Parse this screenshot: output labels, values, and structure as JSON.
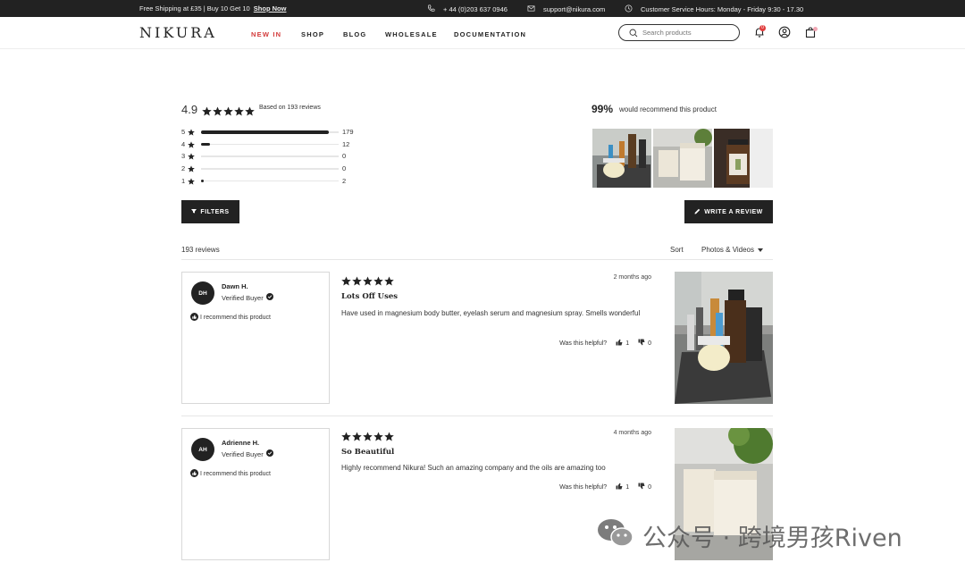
{
  "topbar": {
    "promo_text": "Free Shipping at £35 | Buy 10 Get 10",
    "promo_link": "Shop Now",
    "phone": "+ 44 (0)203 637 0946",
    "email": "support@nikura.com",
    "hours": "Customer Service Hours: Monday - Friday 9:30 - 17.30"
  },
  "header": {
    "logo": "NIKURA",
    "nav": [
      "NEW IN",
      "SHOP",
      "BLOG",
      "WHOLESALE",
      "DOCUMENTATION"
    ],
    "search_placeholder": "Search products",
    "wishlist_count": "0"
  },
  "summary": {
    "average": "4.9",
    "based_on": "Based on 193 reviews",
    "distribution": [
      {
        "stars": "5",
        "count": "179",
        "fraction": 0.927
      },
      {
        "stars": "4",
        "count": "12",
        "fraction": 0.062
      },
      {
        "stars": "3",
        "count": "0",
        "fraction": 0
      },
      {
        "stars": "2",
        "count": "0",
        "fraction": 0
      },
      {
        "stars": "1",
        "count": "2",
        "fraction": 0.01
      }
    ],
    "recommend_pct": "99%",
    "recommend_text": "would recommend this product"
  },
  "buttons": {
    "filters": "FILTERS",
    "write_review": "WRITE A REVIEW"
  },
  "listing": {
    "count": "193 reviews",
    "sort_label": "Sort",
    "sort_value": "Photos & Videos"
  },
  "reviews": [
    {
      "initials": "DH",
      "name": "Dawn H.",
      "verified": "Verified Buyer",
      "recommend": "I recommend this product",
      "rating": 5,
      "date": "2 months ago",
      "title": "Lots Off Uses",
      "body": "Have used in magnesium body butter, eyelash serum and magnesium spray. Smells wonderful",
      "helpful_label": "Was this helpful?",
      "up": "1",
      "down": "0"
    },
    {
      "initials": "AH",
      "name": "Adrienne H.",
      "verified": "Verified Buyer",
      "recommend": "I recommend this product",
      "rating": 5,
      "date": "4 months ago",
      "title": "So Beautiful",
      "body": "Highly recommend Nikura! Such an amazing company and the oils are amazing too",
      "helpful_label": "Was this helpful?",
      "up": "1",
      "down": "0"
    }
  ],
  "watermark": "公众号 · 跨境男孩Riven",
  "colors": {
    "dark": "#222222",
    "accent": "#d33a3a",
    "border": "#d8d8d8"
  }
}
